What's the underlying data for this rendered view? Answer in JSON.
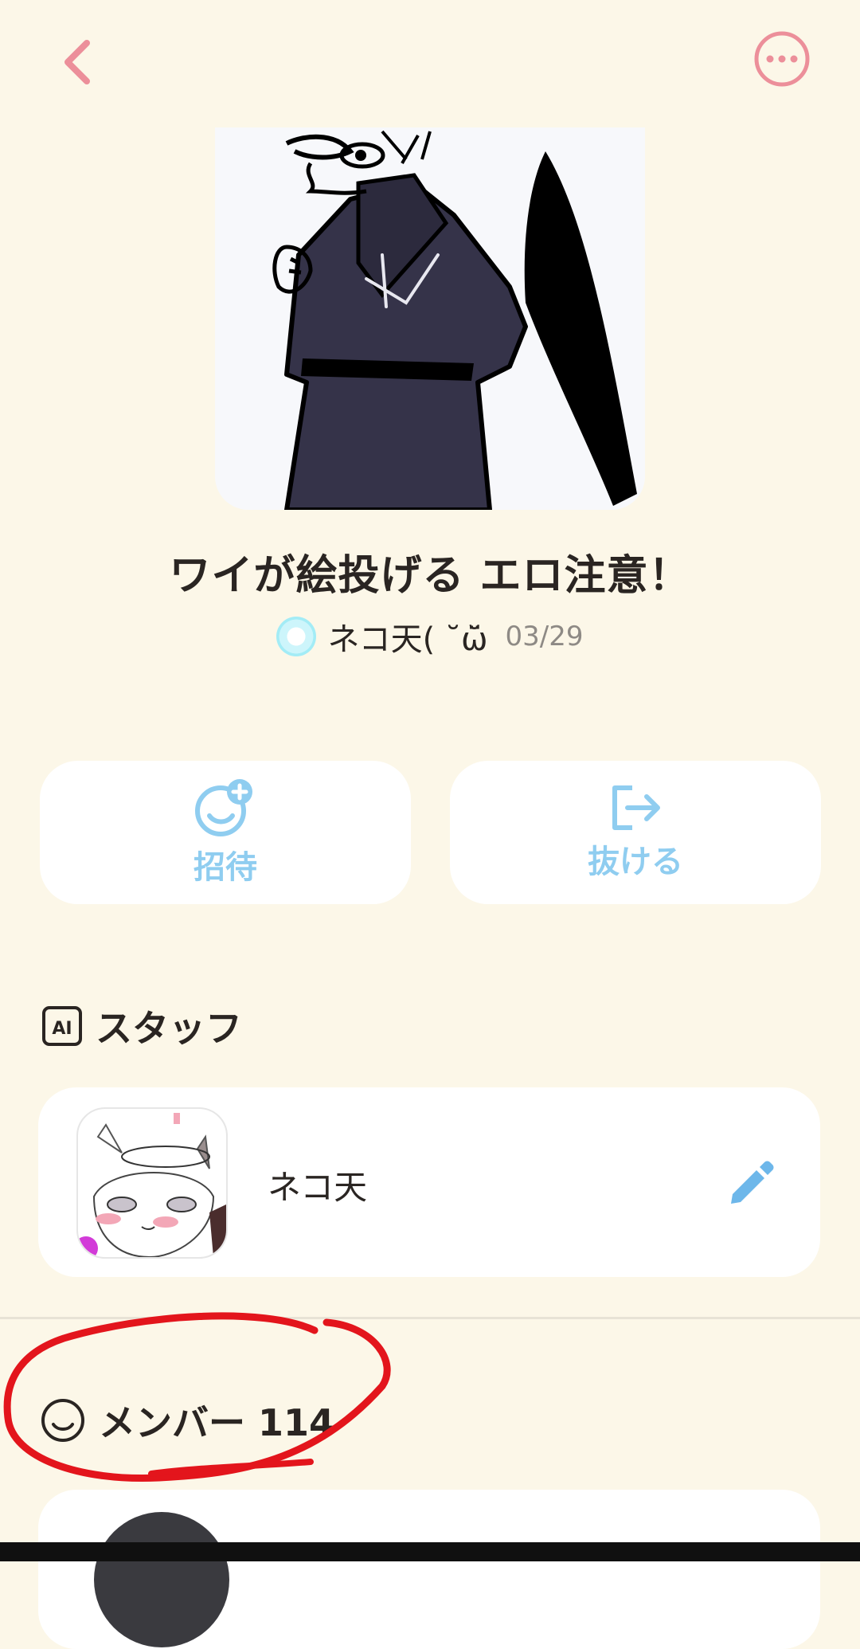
{
  "colors": {
    "background": "#fcf7e8",
    "accent_pink": "#ec8f9a",
    "accent_blue": "#8fcdf0",
    "card": "#ffffff",
    "annotation_red": "#e3151c"
  },
  "topbar": {
    "back_icon": "chevron-left-icon",
    "more_icon": "more-horizontal-icon"
  },
  "group": {
    "title": "ワイが絵投げる エロ注意！",
    "owner_name": "ネコ天(  ˘ω̆̈",
    "created_date": "03/29"
  },
  "actions": {
    "invite_label": "招待",
    "invite_icon": "add-user-smile-icon",
    "leave_label": "抜ける",
    "leave_icon": "exit-icon"
  },
  "staff": {
    "heading": "スタッフ",
    "heading_icon": "ai-badge-icon",
    "badge_text": "AI",
    "items": [
      {
        "name": "ネコ天",
        "edit_icon": "pencil-icon"
      }
    ]
  },
  "members": {
    "heading": "メンバー 114",
    "heading_icon": "smile-icon"
  }
}
